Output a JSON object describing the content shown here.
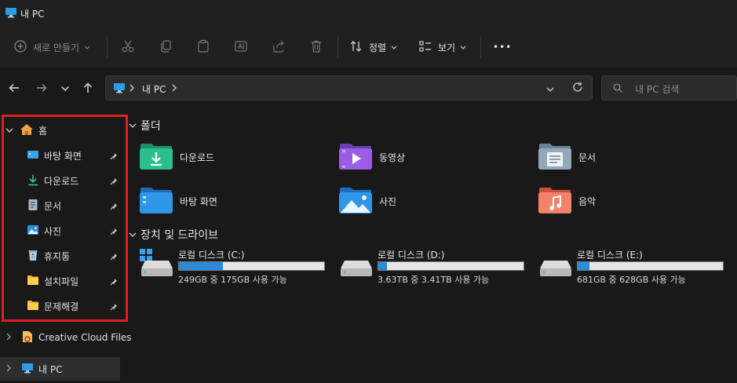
{
  "window": {
    "title": "내 PC"
  },
  "toolbar": {
    "new_label": "새로 만들기",
    "sort_label": "정렬",
    "view_label": "보기",
    "more_label": "•••"
  },
  "address": {
    "path": [
      "내 PC"
    ]
  },
  "search": {
    "placeholder": "내 PC 검색"
  },
  "sidebar": {
    "home": "홈",
    "pinned": [
      {
        "label": "바탕 화면",
        "icon": "desktop-icon"
      },
      {
        "label": "다운로드",
        "icon": "download-icon"
      },
      {
        "label": "문서",
        "icon": "document-icon"
      },
      {
        "label": "사진",
        "icon": "pictures-icon"
      },
      {
        "label": "휴지통",
        "icon": "recycle-bin-icon"
      },
      {
        "label": "설치파일",
        "icon": "folder-icon"
      },
      {
        "label": "문제해결",
        "icon": "folder-icon"
      }
    ],
    "creative_cloud": "Creative Cloud Files",
    "this_pc": "내 PC"
  },
  "content": {
    "folders_title": "폴더",
    "folders": [
      {
        "label": "다운로드",
        "icon": "download-folder-icon"
      },
      {
        "label": "동영상",
        "icon": "videos-folder-icon"
      },
      {
        "label": "문서",
        "icon": "documents-folder-icon"
      },
      {
        "label": "바탕 화면",
        "icon": "desktop-folder-icon"
      },
      {
        "label": "사진",
        "icon": "pictures-folder-icon"
      },
      {
        "label": "음악",
        "icon": "music-folder-icon"
      }
    ],
    "drives_title": "장치 및 드라이브",
    "drives": [
      {
        "name": "로컬 디스크 (C:)",
        "info": "249GB 중 175GB 사용 가능",
        "used_fraction": 0.3
      },
      {
        "name": "로컬 디스크 (D:)",
        "info": "3.63TB 중 3.41TB 사용 가능",
        "used_fraction": 0.06
      },
      {
        "name": "로컬 디스크 (E:)",
        "info": "681GB 중 628GB 사용 가능",
        "used_fraction": 0.08
      }
    ]
  },
  "colors": {
    "accent": "#2b8ad9",
    "highlight_box": "#e01e1e",
    "background": "#191919"
  }
}
